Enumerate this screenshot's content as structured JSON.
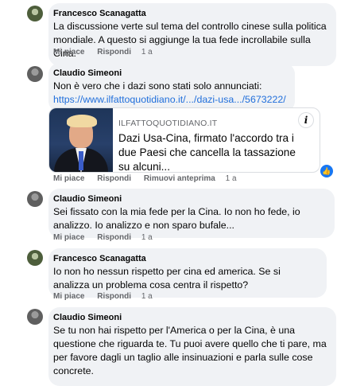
{
  "actions": {
    "like": "Mi piace",
    "reply": "Rispondi",
    "remove_preview": "Rimuovi anteprima"
  },
  "comments": [
    {
      "author": "Francesco Scanagatta",
      "text": "La discussione verte sul tema del controllo cinese sulla politica mondiale. A questo si aggiunge la tua fede incrollabile sulla Cina.",
      "time": "1 a"
    },
    {
      "author": "Claudio Simeoni",
      "text": "Non è vero che i dazi sono stati solo annunciati:",
      "link": "https://www.ilfattoquotidiano.it/.../dazi-usa.../5673222/",
      "time": "1 a",
      "preview": {
        "site": "ILFATTOQUOTIDIANO.IT",
        "title": "Dazi Usa-Cina, firmato l'accordo tra i due Paesi che cancella la tassazione su alcuni...",
        "info": "i"
      },
      "reaction_icon": "thumbs-up-icon"
    },
    {
      "author": "Claudio Simeoni",
      "text": "Sei fissato con la mia fede per la Cina. Io non ho fede, io analizzo. Io analizzo e non sparo bufale...",
      "time": "1 a"
    },
    {
      "author": "Francesco Scanagatta",
      "text": "Io non ho nessun rispetto per cina ed america. Se si analizza un problema cosa centra il rispetto?",
      "time": "1 a"
    },
    {
      "author": "Claudio Simeoni",
      "text": "Se tu non hai rispetto per l'America o per la Cina, è una questione che riguarda te. Tu puoi avere quello che ti pare, ma per favore dagli un taglio alle insinuazioni e parla sulle cose concrete."
    }
  ],
  "colors": {
    "link": "#216fdb",
    "bubble": "#f0f2f5",
    "muted": "#65676b",
    "reaction": "#1877f2"
  }
}
